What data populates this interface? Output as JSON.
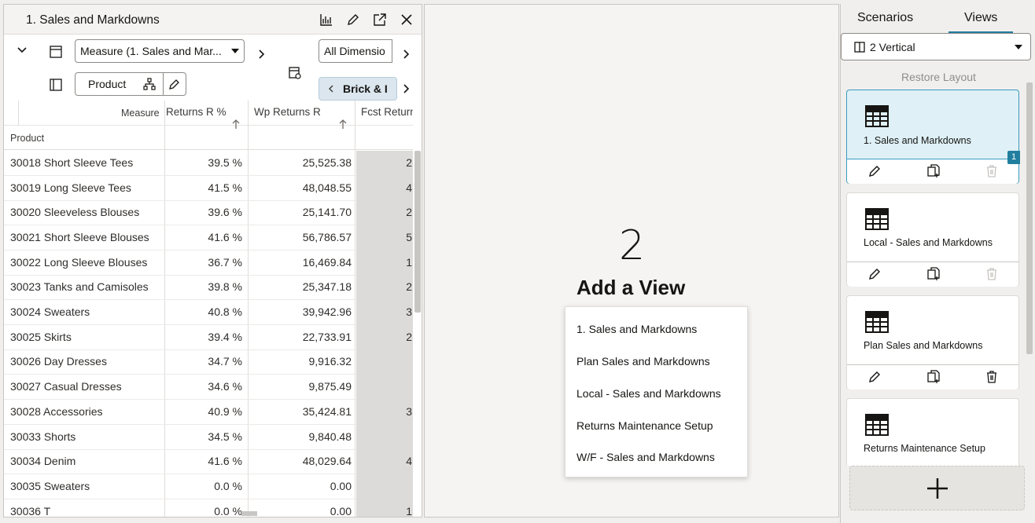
{
  "view_panel": {
    "title": "1. Sales and Markdowns",
    "measure_select": "Measure (1. Sales and Mar...",
    "dimension_select": "All Dimensio",
    "product_button": "Product",
    "brick_pill": "Brick & I"
  },
  "grid": {
    "measure_header": "Measure",
    "product_header": "Product",
    "columns": [
      "Returns R %",
      "Wp Returns R",
      "Fcst Return"
    ],
    "rows": [
      {
        "product": "30018 Short Sleeve Tees",
        "returns_r_pct": "39.5 %",
        "wp_returns_r": "25,525.38",
        "fcst_return": "2"
      },
      {
        "product": "30019 Long Sleeve Tees",
        "returns_r_pct": "41.5 %",
        "wp_returns_r": "48,048.55",
        "fcst_return": "4"
      },
      {
        "product": "30020 Sleeveless Blouses",
        "returns_r_pct": "39.6 %",
        "wp_returns_r": "25,141.70",
        "fcst_return": "2"
      },
      {
        "product": "30021 Short Sleeve Blouses",
        "returns_r_pct": "41.6 %",
        "wp_returns_r": "56,786.57",
        "fcst_return": "5"
      },
      {
        "product": "30022 Long Sleeve Blouses",
        "returns_r_pct": "36.7 %",
        "wp_returns_r": "16,469.84",
        "fcst_return": "1"
      },
      {
        "product": "30023 Tanks and Camisoles",
        "returns_r_pct": "39.8 %",
        "wp_returns_r": "25,347.18",
        "fcst_return": "2"
      },
      {
        "product": "30024 Sweaters",
        "returns_r_pct": "40.8 %",
        "wp_returns_r": "39,942.96",
        "fcst_return": "3"
      },
      {
        "product": "30025 Skirts",
        "returns_r_pct": "39.4 %",
        "wp_returns_r": "22,733.91",
        "fcst_return": "2"
      },
      {
        "product": "30026 Day Dresses",
        "returns_r_pct": "34.7 %",
        "wp_returns_r": "9,916.32",
        "fcst_return": ""
      },
      {
        "product": "30027 Casual Dresses",
        "returns_r_pct": "34.6 %",
        "wp_returns_r": "9,875.49",
        "fcst_return": ""
      },
      {
        "product": "30028 Accessories",
        "returns_r_pct": "40.9 %",
        "wp_returns_r": "35,424.81",
        "fcst_return": "3"
      },
      {
        "product": "30033 Shorts",
        "returns_r_pct": "34.5 %",
        "wp_returns_r": "9,840.48",
        "fcst_return": ""
      },
      {
        "product": "30034 Denim",
        "returns_r_pct": "41.6 %",
        "wp_returns_r": "48,029.64",
        "fcst_return": "4"
      },
      {
        "product": "30035 Sweaters",
        "returns_r_pct": "0.0 %",
        "wp_returns_r": "0.00",
        "fcst_return": ""
      },
      {
        "product": "30036 T",
        "returns_r_pct": "0.0 %",
        "wp_returns_r": "0.00",
        "fcst_return": "1"
      }
    ]
  },
  "middle": {
    "number": "2",
    "heading": "Add a View",
    "menu": [
      "1. Sales and Markdowns",
      "Plan Sales and Markdowns",
      "Local - Sales and Markdowns",
      "Returns Maintenance Setup",
      "W/F - Sales and Markdowns"
    ]
  },
  "right": {
    "tabs": [
      "Scenarios",
      "Views"
    ],
    "active_tab": "Views",
    "layout_select": "2 Vertical",
    "restore_layout": "Restore Layout",
    "cards": [
      {
        "label": "1. Sales and Markdowns",
        "badge": "1",
        "selected": true,
        "delete_enabled": false
      },
      {
        "label": "Local - Sales and Markdowns",
        "selected": false,
        "delete_enabled": false
      },
      {
        "label": "Plan Sales and Markdowns",
        "selected": false,
        "delete_enabled": true
      },
      {
        "label": "Returns Maintenance Setup",
        "selected": false,
        "delete_enabled": true
      }
    ]
  },
  "colors": {
    "accent": "#227e9e",
    "selected_card": "#dff1f7",
    "readonly_cell": "#dcdbda"
  }
}
